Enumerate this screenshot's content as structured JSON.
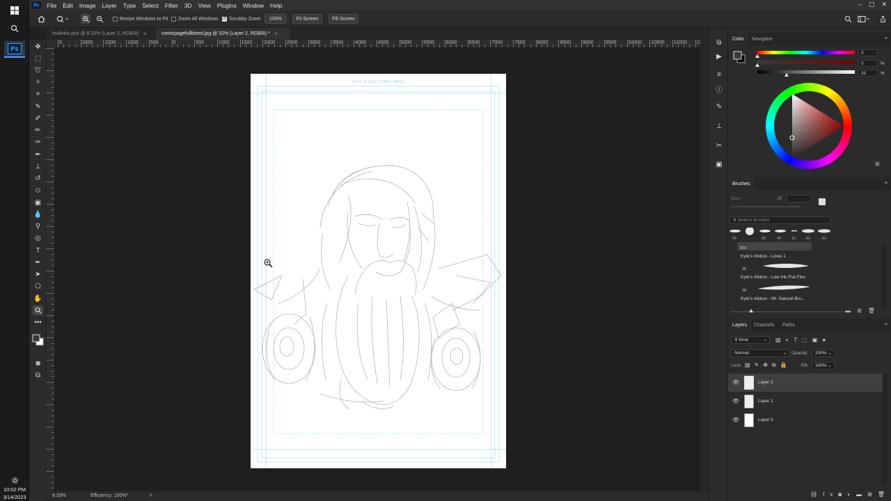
{
  "taskbar": {
    "clock_time": "10:02 PM",
    "clock_date": "3/14/2023",
    "icons": [
      "windows-icon",
      "search-icon",
      "photoshop-app-icon",
      "settings-icon"
    ]
  },
  "menubar": {
    "logo": "Ps",
    "items": [
      "File",
      "Edit",
      "Image",
      "Layer",
      "Type",
      "Select",
      "Filter",
      "3D",
      "View",
      "Plugins",
      "Window",
      "Help"
    ]
  },
  "options": {
    "resize_windows": "Resize Windows to Fit",
    "zoom_all_windows": "Zoom All Windows",
    "scrubby_zoom": "Scrubby Zoom",
    "zoom_value": "100%",
    "fit_screen": "Fit Screen",
    "fill_screen": "Fill Screen"
  },
  "tabs": [
    {
      "label": "hulkinks.psd @ 8.33% (Layer 2, RGB/8)",
      "active": false
    },
    {
      "label": "comicpagefullbleed.jpg @ 32% (Layer 2, RGB/8) *",
      "active": true
    }
  ],
  "ruler": {
    "labels": [
      "0",
      "2000",
      "1500",
      "1000",
      "500",
      "0",
      "500",
      "1000",
      "1500",
      "2000",
      "2500",
      "3000",
      "3500",
      "4000",
      "4500",
      "5000",
      "5500",
      "6000",
      "6500",
      "7000",
      "7500",
      "8000",
      "8500",
      "9000",
      "9500",
      "10000",
      "10500",
      "11000",
      "11500"
    ]
  },
  "document": {
    "header_text": "FULL BLEED COMIC PAGE"
  },
  "status": {
    "zoom": "8.33%",
    "efficiency": "Efficiency: 100%*",
    "arrow": ">"
  },
  "color_panel": {
    "tabs": [
      "Color",
      "Navigator"
    ],
    "values": [
      "0",
      "0",
      "31"
    ],
    "units": [
      "",
      "%",
      "%"
    ]
  },
  "brushes_panel": {
    "title": "Brushes",
    "size_label": "Size:",
    "search_placeholder": "Search Brushes",
    "presets": [
      "35",
      "",
      "25",
      "40",
      "15",
      "62",
      "62"
    ],
    "top_size": "800",
    "items": [
      {
        "size": "",
        "name": "Kyle's Inkbox - Lines 1"
      },
      {
        "size": "35",
        "name": "Kyle's Inkbox - Low Ink Flat Flex"
      },
      {
        "size": "30",
        "name": "Kyle's Inkbox - Mr. Natural Bru..."
      }
    ]
  },
  "layers_panel": {
    "tabs": [
      "Layers",
      "Channels",
      "Paths"
    ],
    "kind": "Kind",
    "blend_mode": "Normal",
    "opacity_label": "Opacity:",
    "opacity_value": "100%",
    "lock_label": "Lock:",
    "fill_label": "Fill:",
    "fill_value": "100%",
    "layers": [
      {
        "name": "Layer 2",
        "selected": true,
        "thumb": "checker"
      },
      {
        "name": "Layer 1",
        "selected": false,
        "thumb": "checker"
      },
      {
        "name": "Layer 0",
        "selected": false,
        "thumb": "white"
      }
    ]
  },
  "colors": {
    "menubar": "#323232",
    "panel": "#2b2b2b",
    "canvas_bg": "#1f1f1f",
    "accent": "#31a8ff"
  }
}
